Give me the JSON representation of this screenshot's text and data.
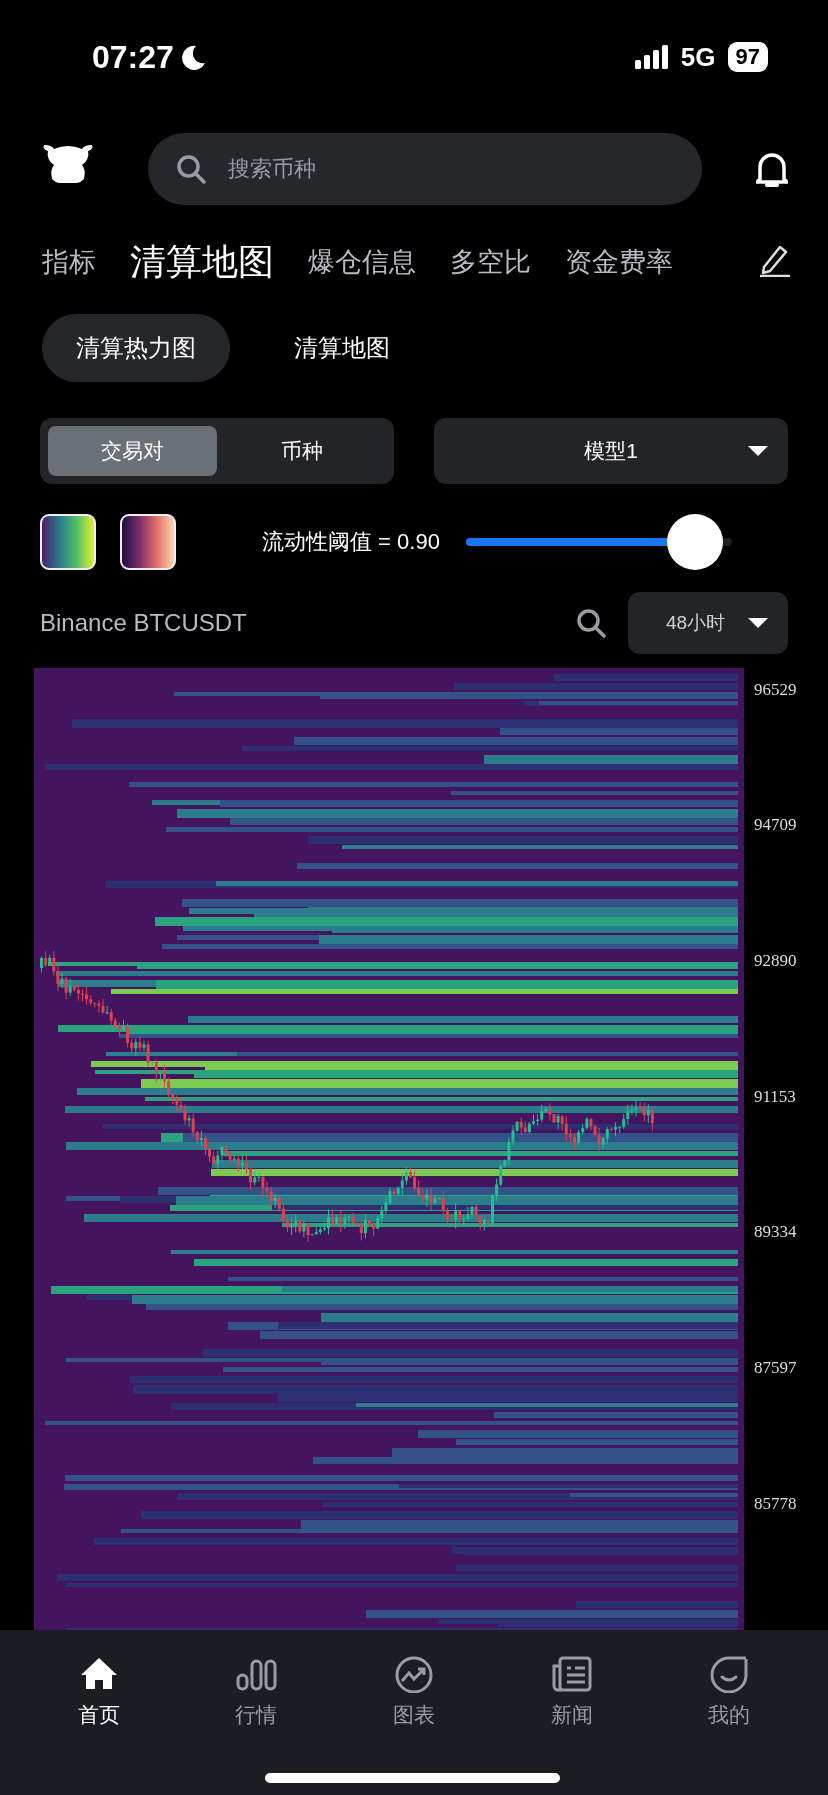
{
  "status_bar": {
    "time": "07:27",
    "network": "5G",
    "battery": "97"
  },
  "search": {
    "placeholder": "搜索币种"
  },
  "tabs": [
    {
      "label": "指标",
      "selected": false
    },
    {
      "label": "清算地图",
      "selected": true
    },
    {
      "label": "爆仓信息",
      "selected": false
    },
    {
      "label": "多空比",
      "selected": false
    },
    {
      "label": "资金费率",
      "selected": false
    }
  ],
  "chart_types": [
    {
      "label": "清算热力图",
      "selected": true
    },
    {
      "label": "清算地图",
      "selected": false
    }
  ],
  "scope_toggle": [
    {
      "label": "交易对",
      "selected": true
    },
    {
      "label": "币种",
      "selected": false
    }
  ],
  "model_dropdown": {
    "value": "模型1"
  },
  "threshold": {
    "label": "流动性阈值 = 0.90",
    "level": 0.86
  },
  "pair": {
    "label": "Binance BTCUSDT"
  },
  "period_dropdown": {
    "value": "48小时"
  },
  "price_axis": [
    "96529",
    "94709",
    "92890",
    "91153",
    "89334",
    "87597",
    "85778"
  ],
  "bottom_nav": [
    {
      "label": "首页",
      "kind": "home",
      "selected": true
    },
    {
      "label": "行情",
      "kind": "bars",
      "selected": false
    },
    {
      "label": "图表",
      "kind": "trend",
      "selected": false
    },
    {
      "label": "新闻",
      "kind": "news",
      "selected": false
    },
    {
      "label": "我的",
      "kind": "smile",
      "selected": false
    }
  ]
}
